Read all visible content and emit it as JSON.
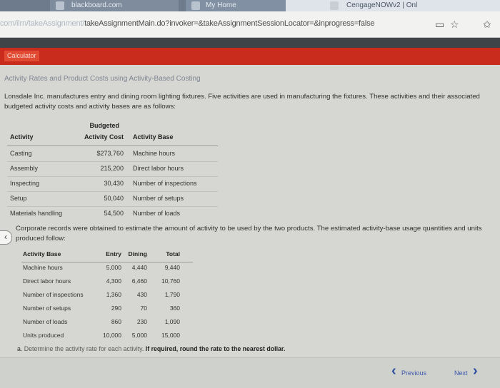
{
  "browser": {
    "tabs": [
      {
        "label": "blackboard.com"
      },
      {
        "label": "My Home"
      },
      {
        "label": "CengageNOWv2 | Onl"
      }
    ],
    "url_dim": "com/ilrn/takeAssignment/",
    "url_main": "takeAssignmentMain.do?invoker=&takeAssignmentSessionLocator=&inprogress=false"
  },
  "toolbar": {
    "calculator_label": "Calculator"
  },
  "problem": {
    "title": "Activity Rates and Product Costs using Activity-Based Costing",
    "intro": "Lonsdale Inc. manufactures entry and dining room lighting fixtures. Five activities are used in manufacturing the fixtures. These activities and their associated budgeted activity costs and activity bases are as follows:",
    "budget_table": {
      "header_budgeted": "Budgeted",
      "headers": [
        "Activity",
        "Activity Cost",
        "Activity Base"
      ],
      "rows": [
        {
          "activity": "Casting",
          "cost": "$273,760",
          "base": "Machine hours"
        },
        {
          "activity": "Assembly",
          "cost": "215,200",
          "base": "Direct labor hours"
        },
        {
          "activity": "Inspecting",
          "cost": "30,430",
          "base": "Number of inspections"
        },
        {
          "activity": "Setup",
          "cost": "50,040",
          "base": "Number of setups"
        },
        {
          "activity": "Materials handling",
          "cost": "54,500",
          "base": "Number of loads"
        }
      ]
    },
    "records_text": "Corporate records were obtained to estimate the amount of activity to be used by the two products. The estimated activity-base usage quantities and units produced follow:",
    "usage_table": {
      "headers": [
        "Activity Base",
        "Entry",
        "Dining",
        "Total"
      ],
      "rows": [
        {
          "base": "Machine hours",
          "entry": "5,000",
          "dining": "4,440",
          "total": "9,440"
        },
        {
          "base": "Direct labor hours",
          "entry": "4,300",
          "dining": "6,460",
          "total": "10,760"
        },
        {
          "base": "Number of inspections",
          "entry": "1,360",
          "dining": "430",
          "total": "1,790"
        },
        {
          "base": "Number of setups",
          "entry": "290",
          "dining": "70",
          "total": "360"
        },
        {
          "base": "Number of loads",
          "entry": "860",
          "dining": "230",
          "total": "1,090"
        },
        {
          "base": "Units produced",
          "entry": "10,000",
          "dining": "5,000",
          "total": "15,000"
        }
      ]
    },
    "question_prefix": "a.",
    "question_text": "Determine the activity rate for each activity.",
    "question_bold": "If required, round the rate to the nearest dollar."
  },
  "footer": {
    "previous_label": "Previous",
    "next_label": "Next"
  }
}
